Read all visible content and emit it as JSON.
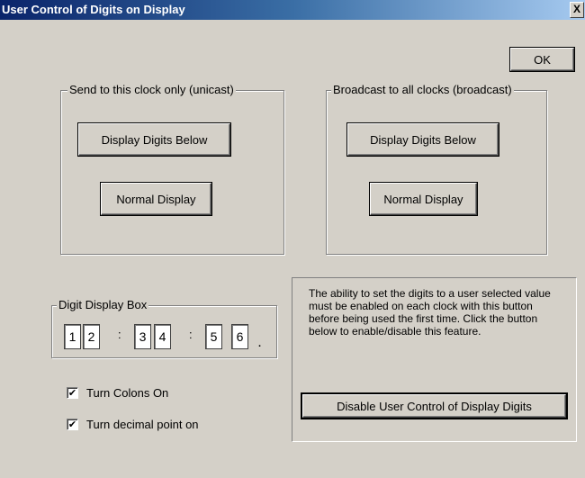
{
  "window": {
    "title": "User Control of Digits on Display",
    "close_symbol": "X"
  },
  "ok_label": "OK",
  "unicast": {
    "legend": "Send to this clock only (unicast)",
    "display_digits_label": "Display Digits Below",
    "normal_display_label": "Normal Display"
  },
  "broadcast": {
    "legend": "Broadcast to all clocks (broadcast)",
    "display_digits_label": "Display Digits Below",
    "normal_display_label": "Normal Display"
  },
  "digit_box": {
    "legend": "Digit Display Box",
    "digits": [
      "1",
      "2",
      "3",
      "4",
      "5",
      "6"
    ],
    "colon": ":",
    "decimal_point": "."
  },
  "options": {
    "colons_label": "Turn Colons On",
    "colons_checked": true,
    "decimal_label": "Turn decimal point on",
    "decimal_checked": true,
    "check_mark": "✔"
  },
  "info": {
    "text": "The ability to set the digits to a user selected value must be enabled on each clock with this button before being used the first time. Click the button below to enable/disable this feature.",
    "disable_button_label": "Disable User Control of Display Digits"
  }
}
